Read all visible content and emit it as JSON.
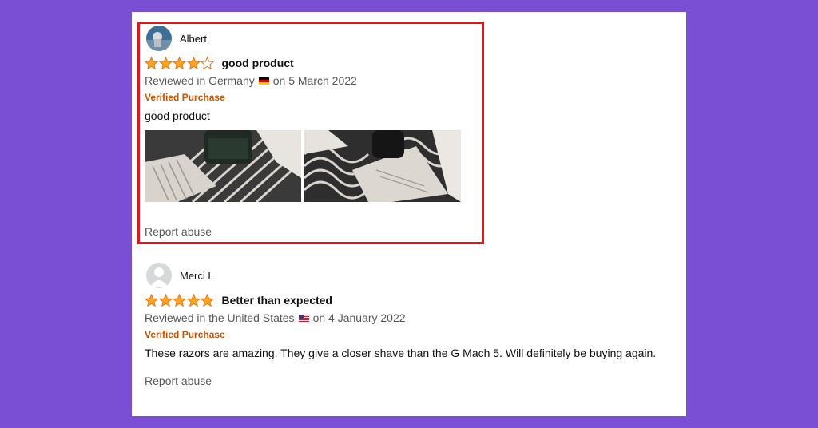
{
  "reviews": [
    {
      "reviewer": "Albert",
      "rating": 4,
      "rating_max": 5,
      "title": "good product",
      "reviewed_in_prefix": "Reviewed in Germany",
      "reviewed_in_suffix": "on 5 March 2022",
      "flag_icon": "germany-flag-icon",
      "verified": "Verified Purchase",
      "body": "good product",
      "photos": [
        "review-photo-1",
        "review-photo-2"
      ],
      "report": "Report abuse",
      "highlighted": true
    },
    {
      "reviewer": "Merci L",
      "rating": 5,
      "rating_max": 5,
      "title": "Better than expected",
      "reviewed_in_prefix": "Reviewed in the United States",
      "reviewed_in_suffix": "on 4 January 2022",
      "flag_icon": "us-flag-icon",
      "verified": "Verified Purchase",
      "body": "These razors are amazing. They give a closer shave than the G Mach 5. Will definitely be buying again.",
      "report": "Report abuse",
      "highlighted": false
    }
  ],
  "colors": {
    "background": "#7a4fd3",
    "card": "#ffffff",
    "star": "#ffa41c",
    "star_outline": "#de7921",
    "verified": "#c45500",
    "highlight_border": "#e8141c"
  }
}
